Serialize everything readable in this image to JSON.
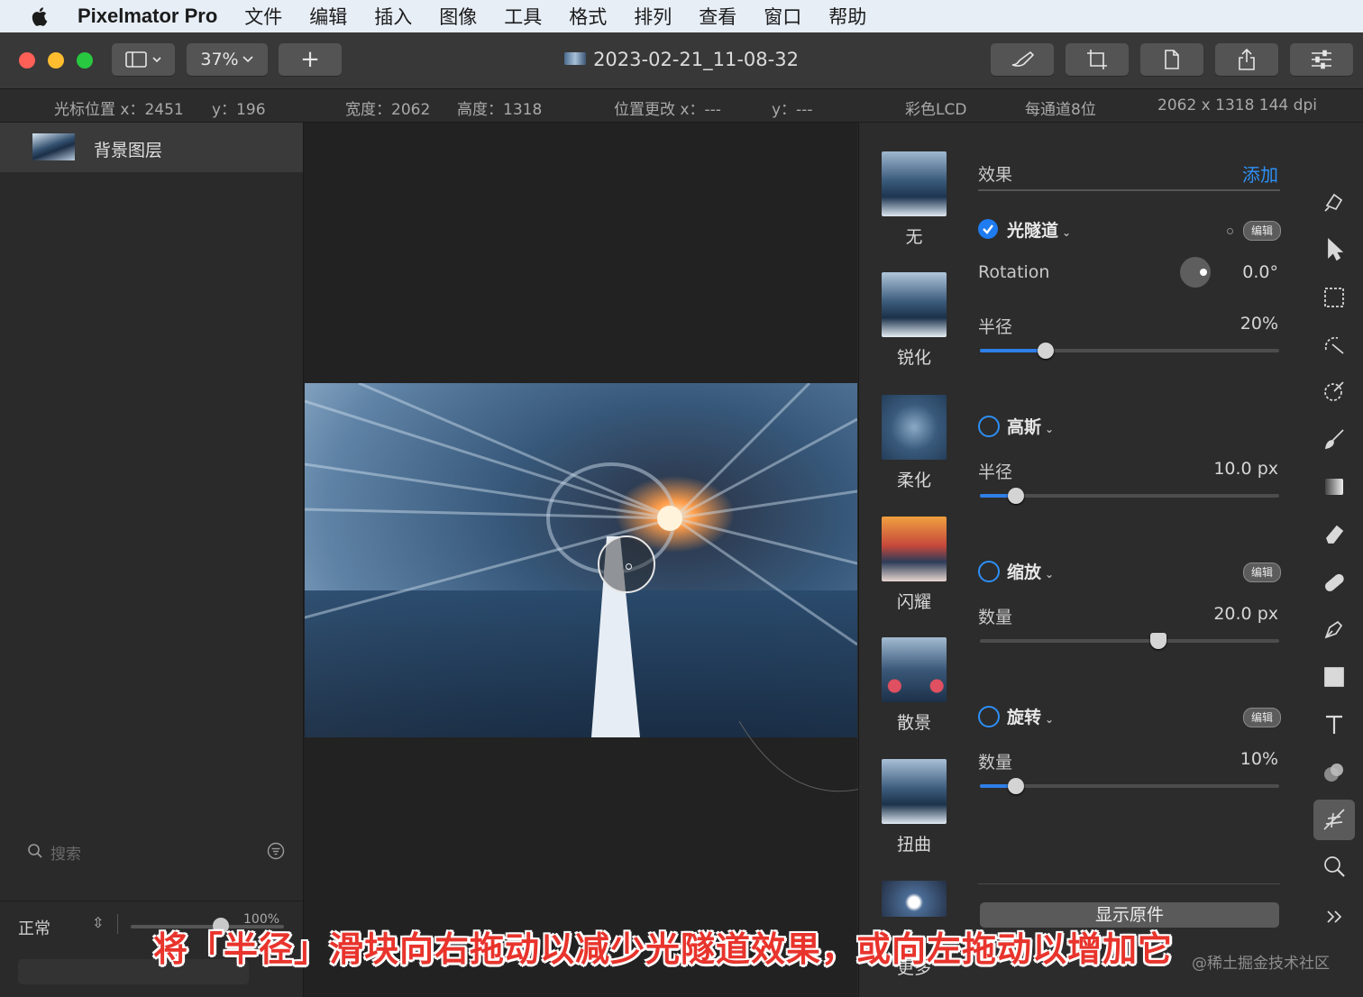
{
  "menubar": {
    "app_name": "Pixelmator Pro",
    "items": [
      "文件",
      "编辑",
      "插入",
      "图像",
      "工具",
      "格式",
      "排列",
      "查看",
      "窗口",
      "帮助"
    ]
  },
  "toolbar": {
    "zoom": "37%",
    "add_symbol": "+",
    "document_title": "2023-02-21_11-08-32"
  },
  "infobar": {
    "cursor_x": "光标位置 x：2451",
    "cursor_y": "y：196",
    "width": "宽度：2062",
    "height": "高度：1318",
    "pos_change_x": "位置更改 x：---",
    "pos_change_y": "y：---",
    "color_profile": "彩色LCD",
    "bit_depth": "每通道8位",
    "dimensions": "2062 x 1318 144 dpi"
  },
  "layers": {
    "layer_name": "背景图层",
    "blend_mode": "正常",
    "opacity": "100%",
    "search_placeholder": "搜索"
  },
  "presets": [
    "无",
    "锐化",
    "柔化",
    "闪耀",
    "散景",
    "扭曲",
    "更多"
  ],
  "effects": {
    "header": "效果",
    "add_label": "添加",
    "edit_label": "编辑",
    "light_tunnel": {
      "name": "光隧道",
      "enabled": true,
      "rotation_label": "Rotation",
      "rotation_value": "0.0°",
      "radius_label": "半径",
      "radius_value": "20%",
      "radius_fraction": 0.22
    },
    "gaussian": {
      "name": "高斯",
      "enabled": false,
      "radius_label": "半径",
      "radius_value": "10.0 px",
      "radius_fraction": 0.12
    },
    "zoom": {
      "name": "缩放",
      "enabled": false,
      "amount_label": "数量",
      "amount_value": "20.0 px",
      "amount_fraction": 0.595
    },
    "spin": {
      "name": "旋转",
      "enabled": false,
      "amount_label": "数量",
      "amount_value": "10%",
      "amount_fraction": 0.12
    },
    "show_original": "显示原件"
  },
  "subtitle": "将「半径」滑块向右拖动以减少光隧道效果，或向左拖动以增加它",
  "watermark": "@稀土掘金技术社区",
  "colors": {
    "accent": "#2e7fe8",
    "close": "#fe5f57",
    "minimize": "#febc2e",
    "zoom": "#28c840",
    "subtitle": "#e8342c"
  }
}
